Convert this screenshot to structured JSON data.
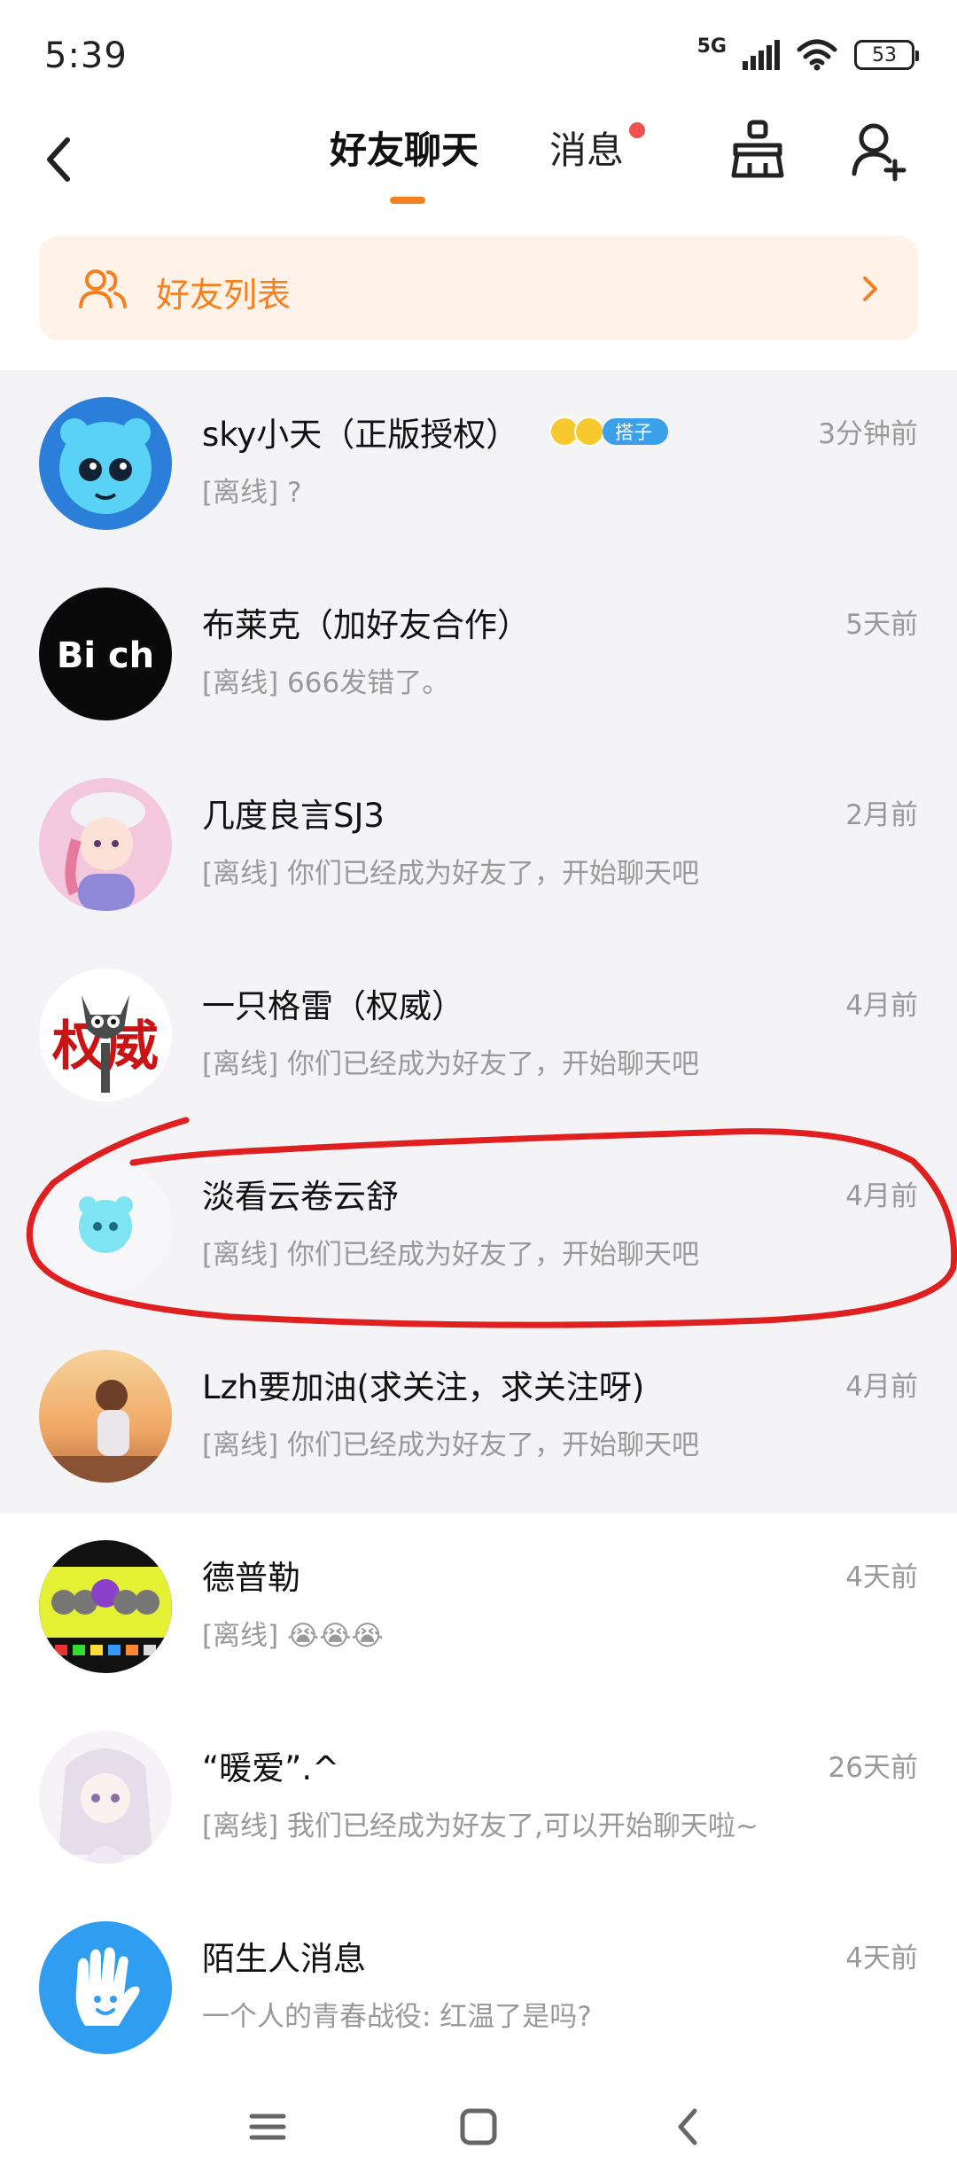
{
  "status_bar": {
    "time": "5:39",
    "network": "5G",
    "battery": "53"
  },
  "header": {
    "tabs": [
      {
        "label": "好友聊天",
        "active": true
      },
      {
        "label": "消息",
        "has_dot": true
      }
    ],
    "icons": [
      "back-icon",
      "broom-icon",
      "add-friend-icon"
    ]
  },
  "friend_list_banner": {
    "label": "好友列表"
  },
  "conversations": [
    {
      "name": "sky小天（正版授权）",
      "badge": "搭子",
      "preview": "[离线] ?",
      "time": "3分钟前"
    },
    {
      "name": "布莱克（加好友合作）",
      "preview": "[离线] 666发错了。",
      "time": "5天前",
      "avatar_text": "Bi ch"
    },
    {
      "name": "几度良言SJ3",
      "preview": "[离线] 你们已经成为好友了，开始聊天吧",
      "time": "2月前"
    },
    {
      "name": "一只格雷（权威）",
      "preview": "[离线] 你们已经成为好友了，开始聊天吧",
      "time": "4月前",
      "avatar_text": "权威"
    },
    {
      "name": "淡看云卷云舒",
      "preview": "[离线] 你们已经成为好友了，开始聊天吧",
      "time": "4月前"
    },
    {
      "name": "Lzh要加油(求关注，求关注呀)",
      "preview": "[离线] 你们已经成为好友了，开始聊天吧",
      "time": "4月前"
    },
    {
      "name": "德普勒",
      "preview": "[离线] 😭😭😭",
      "time": "4天前"
    },
    {
      "name": "“暖爱”.^",
      "preview": "[离线] 我们已经成为好友了,可以开始聊天啦~",
      "time": "26天前"
    },
    {
      "name": "陌生人消息",
      "preview": "一个人的青春战役: 红温了是吗?",
      "time": "4天前"
    }
  ],
  "colors": {
    "accent": "#f5801f",
    "red_dot": "#f05050",
    "annotation": "#e02020",
    "badge": "#3aa0ea"
  }
}
